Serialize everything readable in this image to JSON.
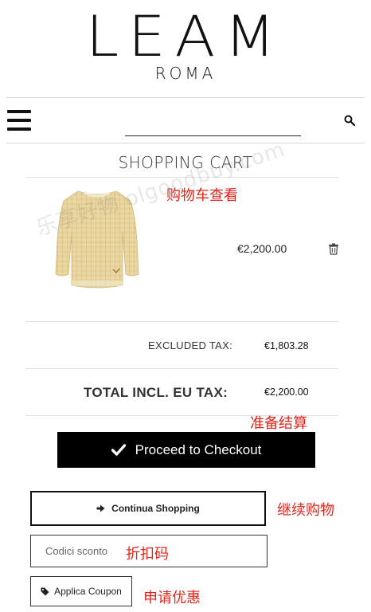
{
  "header": {
    "logo_main": "LEAM",
    "logo_sub": "ROMA"
  },
  "search": {
    "placeholder": ""
  },
  "cart": {
    "title": "SHOPPING CART",
    "item": {
      "price": "€2,200.00"
    },
    "excluded_tax_label": "EXCLUDED TAX:",
    "excluded_tax_value": "€1,803.28",
    "total_label": "TOTAL INCL. EU TAX:",
    "total_value": "€2,200.00"
  },
  "actions": {
    "checkout_label": "Proceed to Checkout",
    "continue_label": "Continua Shopping",
    "coupon_placeholder": "Codici sconto",
    "apply_label": "Applica Coupon"
  },
  "annotations": {
    "view_cart": "购物车查看",
    "prepare_checkout": "准备结算",
    "continue_shopping": "继续购物",
    "discount_code": "折扣码",
    "apply_coupon": "申请优惠"
  },
  "watermark": "乐享好物 olgoodbuy.com",
  "colors": {
    "annotation": "#e0261b",
    "button_bg": "#000000",
    "sweater": "#e8d49a"
  },
  "icons": [
    "menu-icon",
    "search-icon",
    "trash-icon",
    "check-icon",
    "arrow-right-icon",
    "tag-icon"
  ]
}
